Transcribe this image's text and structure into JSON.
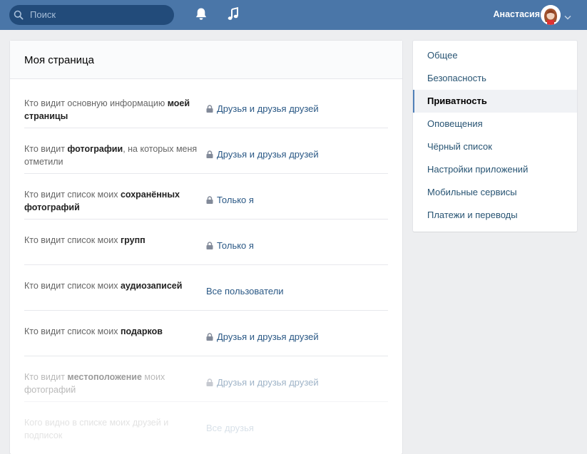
{
  "header": {
    "search_placeholder": "Поиск",
    "user_name": "Анастасия",
    "icons": [
      "search-icon",
      "bell-icon",
      "music-icon",
      "chevron-down-icon"
    ],
    "colors": {
      "bar": "#4a76a8",
      "search_bg": "#224b7a"
    }
  },
  "privacy": {
    "title": "Моя страница",
    "rows": [
      {
        "q_plain": "Кто видит основную информацию ",
        "q_bold": "моей страницы",
        "value": "Друзья и друзья друзей",
        "locked": true
      },
      {
        "q_plain1": "Кто видит ",
        "q_bold": "фотографии",
        "q_plain2": ", на которых меня отметили",
        "value": "Друзья и друзья друзей",
        "locked": true
      },
      {
        "q_plain": "Кто видит список моих ",
        "q_bold": "сохранённых фотографий",
        "value": "Только я",
        "locked": true
      },
      {
        "q_plain": "Кто видит список моих ",
        "q_bold": "групп",
        "value": "Только я",
        "locked": true
      },
      {
        "q_plain": "Кто видит список моих ",
        "q_bold": "аудиозаписей",
        "value": "Все пользователи",
        "locked": false
      },
      {
        "q_plain": "Кто видит список моих ",
        "q_bold": "подарков",
        "value": "Друзья и друзья друзей",
        "locked": true
      },
      {
        "q_plain1": "Кто видит ",
        "q_bold": "местоположение",
        "q_plain2": " моих фотографий",
        "value": "Друзья и друзья друзей",
        "locked": true
      },
      {
        "q_plain": "Кого видно в списке моих друзей и подписок",
        "value": "Все друзья",
        "locked": false
      }
    ]
  },
  "settings_menu": {
    "items": [
      {
        "label": "Общее"
      },
      {
        "label": "Безопасность"
      },
      {
        "label": "Приватность",
        "active": true
      },
      {
        "label": "Оповещения"
      },
      {
        "label": "Чёрный список"
      },
      {
        "label": "Настройки приложений"
      },
      {
        "label": "Мобильные сервисы"
      },
      {
        "label": "Платежи и переводы"
      }
    ]
  }
}
